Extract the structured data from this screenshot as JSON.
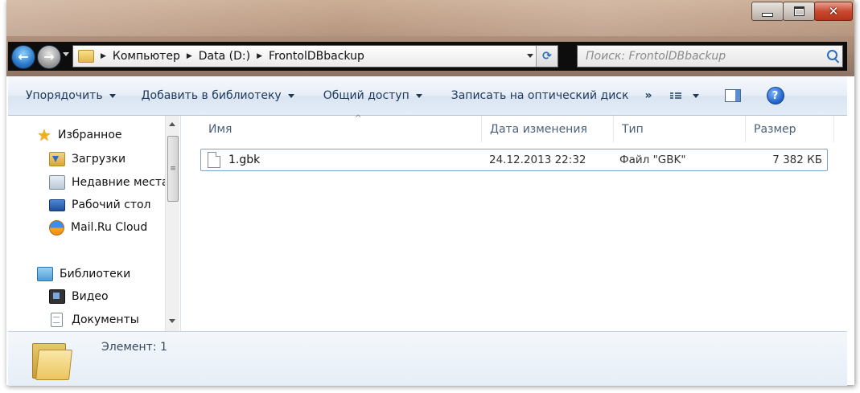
{
  "address": {
    "crumbs": [
      "Компьютер",
      "Data (D:)",
      "FrontolDBbackup"
    ]
  },
  "search": {
    "placeholder": "Поиск: FrontolDBbackup"
  },
  "toolbar": {
    "organize": "Упорядочить",
    "add_library": "Добавить в библиотеку",
    "share": "Общий доступ",
    "burn": "Записать на оптический диск",
    "more": "»",
    "help": "?"
  },
  "nav": {
    "favorites": {
      "label": "Избранное",
      "items": [
        "Загрузки",
        "Недавние места",
        "Рабочий стол",
        "Mail.Ru Cloud"
      ]
    },
    "libraries": {
      "label": "Библиотеки",
      "items": [
        "Видео",
        "Документы"
      ]
    }
  },
  "columns": [
    "Имя",
    "Дата изменения",
    "Тип",
    "Размер"
  ],
  "files": [
    {
      "name": "1.gbk",
      "modified": "24.12.2013 22:32",
      "type": "Файл \"GBK\"",
      "size": "7 382 КБ"
    }
  ],
  "details": {
    "count": "Элемент: 1"
  }
}
